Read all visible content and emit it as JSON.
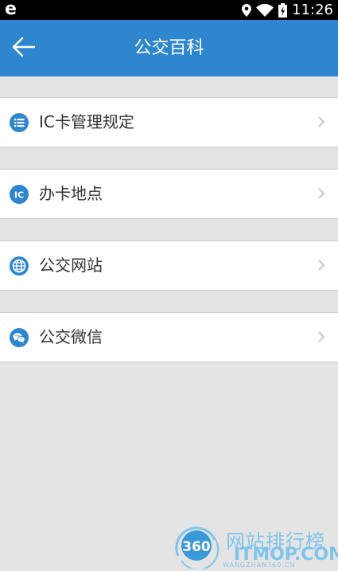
{
  "status_bar": {
    "time": "11:26",
    "left_glyph": "e",
    "icons": [
      "location-icon",
      "wifi-icon",
      "battery-charging-icon"
    ]
  },
  "app_bar": {
    "title": "公交百科",
    "back_icon": "back-arrow-icon",
    "color": "#2e86cf"
  },
  "menu": {
    "items": [
      {
        "label": "IC卡管理规定",
        "icon": "list-icon"
      },
      {
        "label": "办卡地点",
        "icon": "ic-card-icon"
      },
      {
        "label": "公交网站",
        "icon": "globe-icon"
      },
      {
        "label": "公交微信",
        "icon": "wechat-icon"
      }
    ],
    "icon_color": "#2e86cf"
  },
  "watermark": {
    "logo_text": "360",
    "title": "网站排行榜",
    "domain": "ITMOP.COM",
    "subdomain": "WANGZHAN360.CN"
  }
}
